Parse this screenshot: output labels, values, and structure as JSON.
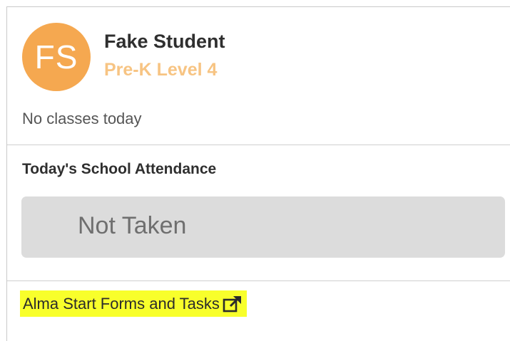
{
  "student": {
    "initials": "FS",
    "name": "Fake Student",
    "level": "Pre-K Level 4",
    "classes_status": "No classes today"
  },
  "attendance": {
    "title": "Today's School Attendance",
    "status": "Not Taken"
  },
  "link": {
    "label": "Alma Start Forms and Tasks",
    "icon": "external-link-icon"
  },
  "colors": {
    "avatar": "#f5a850",
    "level_text": "#f7c483",
    "status_bg": "#dcdcdc",
    "highlight": "#f8ff2b"
  }
}
